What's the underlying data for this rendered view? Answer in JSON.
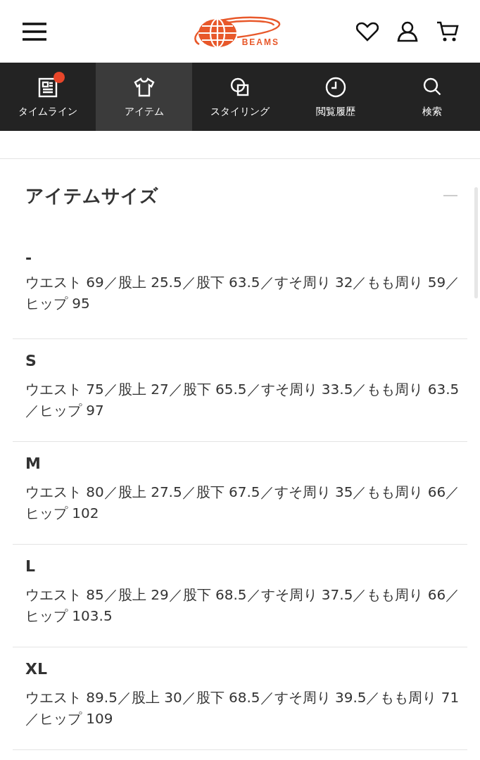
{
  "header": {
    "logo_text": "BEAMS"
  },
  "nav": [
    {
      "label": "タイムライン",
      "kind": "timeline",
      "badge": true,
      "selected": false
    },
    {
      "label": "アイテム",
      "kind": "item",
      "badge": false,
      "selected": true
    },
    {
      "label": "スタイリング",
      "kind": "styling",
      "badge": false,
      "selected": false
    },
    {
      "label": "閲覧履歴",
      "kind": "history",
      "badge": false,
      "selected": false
    },
    {
      "label": "検索",
      "kind": "search",
      "badge": false,
      "selected": false
    }
  ],
  "section": {
    "title": "アイテムサイズ",
    "expanded": true,
    "sizes": [
      {
        "name": "-",
        "measurements": "ウエスト 69／股上 25.5／股下 63.5／すそ周り 32／もも周り 59／ヒップ 95"
      },
      {
        "name": "S",
        "measurements": "ウエスト 75／股上 27／股下 65.5／すそ周り 33.5／もも周り 63.5／ヒップ 97"
      },
      {
        "name": "M",
        "measurements": "ウエスト 80／股上 27.5／股下 67.5／すそ周り 35／もも周り 66／ヒップ 102"
      },
      {
        "name": "L",
        "measurements": "ウエスト 85／股上 29／股下 68.5／すそ周り 37.5／もも周り 66／ヒップ 103.5"
      },
      {
        "name": "XL",
        "measurements": "ウエスト 89.5／股上 30／股下 68.5／すそ周り 39.5／もも周り 71／ヒップ 109"
      }
    ]
  }
}
